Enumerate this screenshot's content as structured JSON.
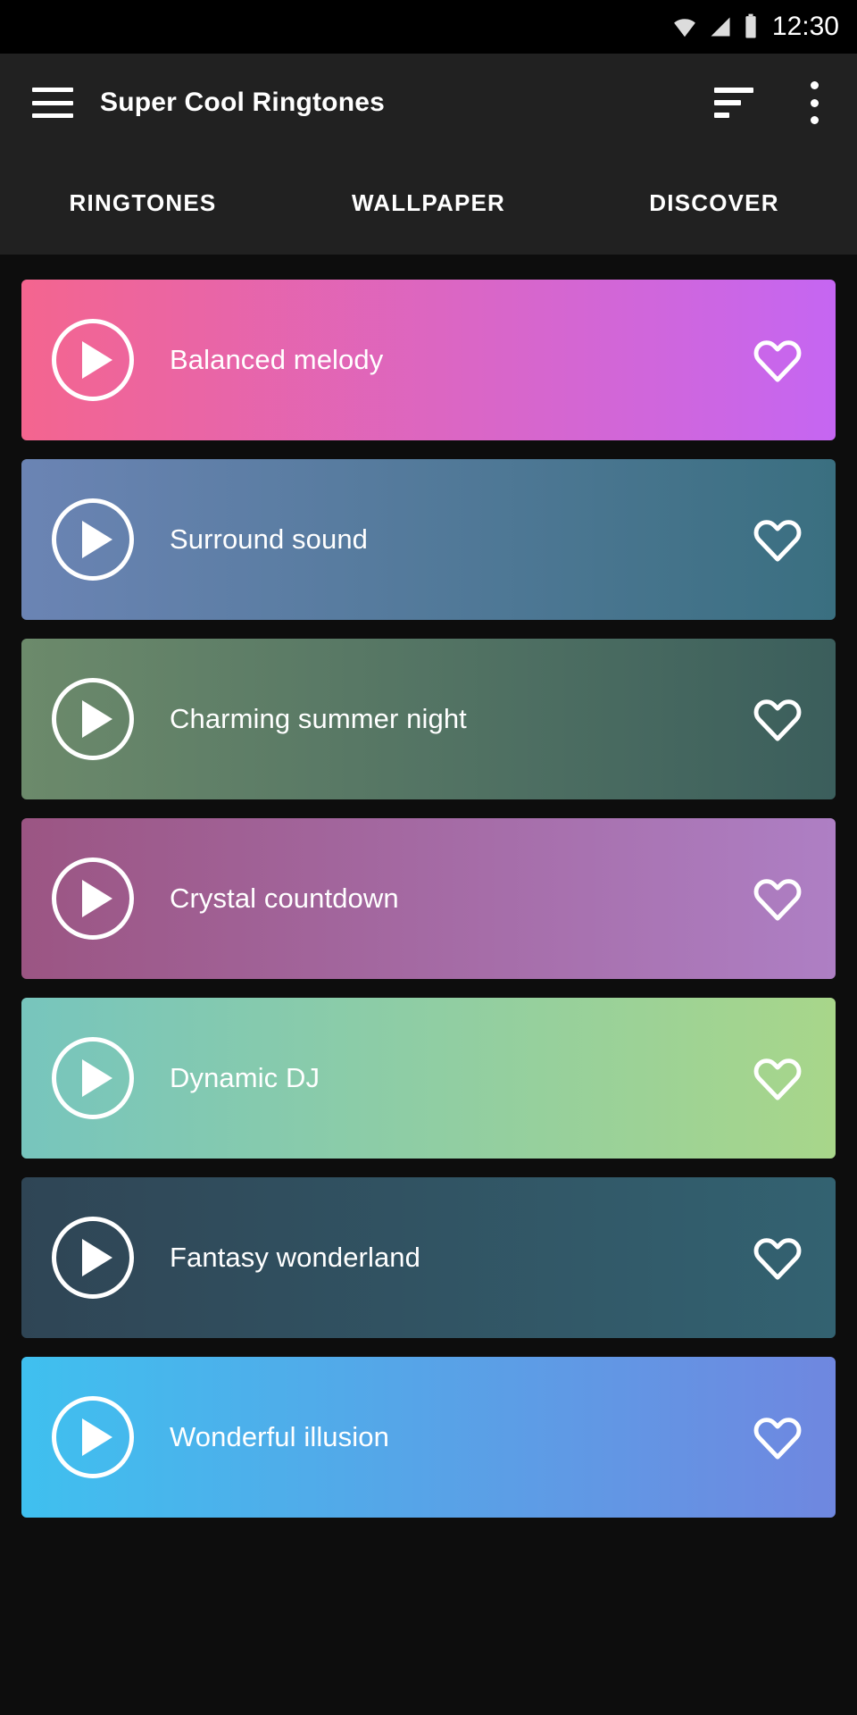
{
  "statusbar": {
    "time": "12:30",
    "icons": [
      "wifi-icon",
      "cellular-signal-icon",
      "battery-icon"
    ]
  },
  "appbar": {
    "menu_icon": "hamburger-menu-icon",
    "title": "Super Cool Ringtones",
    "sort_icon": "sort-icon",
    "overflow_icon": "overflow-menu-icon"
  },
  "tabs": [
    {
      "label": "RINGTONES",
      "selected": true
    },
    {
      "label": "WALLPAPER",
      "selected": false
    },
    {
      "label": "DISCOVER",
      "selected": false
    }
  ],
  "colors": {
    "status_bar_bg": "#000000",
    "app_bar_bg": "#212121",
    "list_bg": "#0d0d0d",
    "text": "#ffffff"
  },
  "ringtones": [
    {
      "title": "Balanced melody",
      "gradient_from": "#f4658f",
      "gradient_to": "#c566f2",
      "play_icon": "play-icon",
      "favorite_icon": "heart-outline-icon",
      "favorited": false
    },
    {
      "title": "Surround sound",
      "gradient_from": "#6b84b4",
      "gradient_to": "#3a6f80",
      "play_icon": "play-icon",
      "favorite_icon": "heart-outline-icon",
      "favorited": false
    },
    {
      "title": "Charming summer night",
      "gradient_from": "#6c8a6b",
      "gradient_to": "#3b5e5c",
      "play_icon": "play-icon",
      "favorite_icon": "heart-outline-icon",
      "favorited": false
    },
    {
      "title": "Crystal countdown",
      "gradient_from": "#9b5583",
      "gradient_to": "#ae7fc4",
      "play_icon": "play-icon",
      "favorite_icon": "heart-outline-icon",
      "favorited": false
    },
    {
      "title": "Dynamic DJ",
      "gradient_from": "#77c5bd",
      "gradient_to": "#a8d68a",
      "play_icon": "play-icon",
      "favorite_icon": "heart-outline-icon",
      "favorited": false
    },
    {
      "title": "Fantasy wonderland",
      "gradient_from": "#2f4555",
      "gradient_to": "#336271",
      "play_icon": "play-icon",
      "favorite_icon": "heart-outline-icon",
      "favorited": false
    },
    {
      "title": "Wonderful illusion",
      "gradient_from": "#3fc0ef",
      "gradient_to": "#6f87e0",
      "play_icon": "play-icon",
      "favorite_icon": "heart-outline-icon",
      "favorited": false
    }
  ]
}
